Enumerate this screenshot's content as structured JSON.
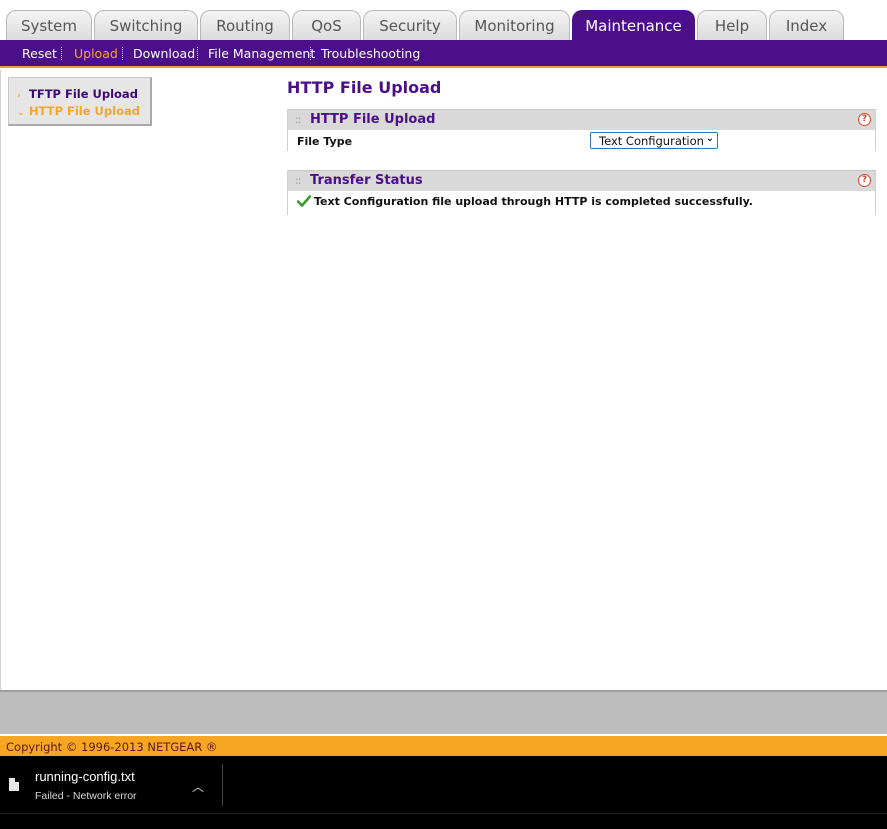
{
  "tabs": [
    {
      "label": "System",
      "active": false
    },
    {
      "label": "Switching",
      "active": false
    },
    {
      "label": "Routing",
      "active": false
    },
    {
      "label": "QoS",
      "active": false
    },
    {
      "label": "Security",
      "active": false
    },
    {
      "label": "Monitoring",
      "active": false
    },
    {
      "label": "Maintenance",
      "active": true
    },
    {
      "label": "Help",
      "active": false
    },
    {
      "label": "Index",
      "active": false
    }
  ],
  "subnav": [
    {
      "label": "Reset",
      "active": false
    },
    {
      "label": "Upload",
      "active": true
    },
    {
      "label": "Download",
      "active": false
    },
    {
      "label": "File Management",
      "active": false
    },
    {
      "label": "Troubleshooting",
      "active": false
    }
  ],
  "leftmenu": [
    {
      "label": "TFTP File Upload",
      "active": false
    },
    {
      "label": "HTTP File Upload",
      "active": true
    }
  ],
  "page_title": "HTTP File Upload",
  "upload_panel": {
    "title": "HTTP File Upload",
    "file_type_label": "File Type",
    "file_type_value": "Text Configuration"
  },
  "status_panel": {
    "title": "Transfer Status",
    "message": "Text Configuration file upload through HTTP is completed successfully."
  },
  "footer": {
    "copyright": "Copyright © 1996-2013 NETGEAR ®"
  },
  "download_bar": {
    "file_name": "running-config.txt",
    "status": "Failed - Network error"
  },
  "colors": {
    "brand_purple": "#4b0f8a",
    "accent_orange": "#f7a624"
  }
}
